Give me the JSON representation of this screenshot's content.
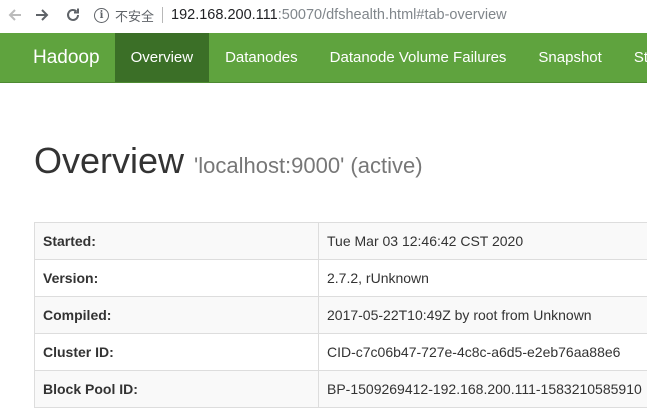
{
  "browser": {
    "back_icon": "arrow-left-icon",
    "forward_icon": "arrow-right-icon",
    "reload_icon": "reload-icon",
    "security_label": "不安全",
    "url_host": "192.168.200.111",
    "url_rest": ":50070/dfshealth.html#tab-overview"
  },
  "navbar": {
    "brand": "Hadoop",
    "items": [
      {
        "label": "Overview"
      },
      {
        "label": "Datanodes"
      },
      {
        "label": "Datanode Volume Failures"
      },
      {
        "label": "Snapshot"
      },
      {
        "label": "Startup Progress"
      }
    ],
    "colors": {
      "background": "#5fa33e",
      "active": "#3b6f27"
    }
  },
  "page": {
    "title": "Overview",
    "subtitle": "'localhost:9000' (active)"
  },
  "summary": {
    "rows": [
      {
        "key": "Started:",
        "value": "Tue Mar 03 12:46:42 CST 2020"
      },
      {
        "key": "Version:",
        "value": "2.7.2, rUnknown"
      },
      {
        "key": "Compiled:",
        "value": "2017-05-22T10:49Z by root from Unknown"
      },
      {
        "key": "Cluster ID:",
        "value": "CID-c7c06b47-727e-4c8c-a6d5-e2eb76aa88e6"
      },
      {
        "key": "Block Pool ID:",
        "value": "BP-1509269412-192.168.200.111-1583210585910"
      }
    ]
  }
}
